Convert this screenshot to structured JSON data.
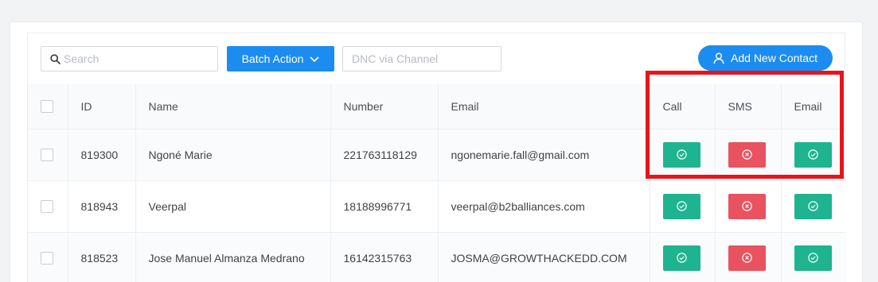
{
  "toolbar": {
    "search_placeholder": "Search",
    "batch_action_label": "Batch Action",
    "dnc_placeholder": "DNC via Channel",
    "add_contact_label": "Add New Contact"
  },
  "table": {
    "headers": {
      "id": "ID",
      "name": "Name",
      "number": "Number",
      "email": "Email",
      "call": "Call",
      "sms": "SMS",
      "email_channel": "Email"
    },
    "rows": [
      {
        "id": "819300",
        "name": "Ngoné Marie",
        "number": "221763118129",
        "email": "ngonemarie.fall@gmail.com",
        "call": "allowed",
        "sms": "blocked",
        "email_channel": "allowed"
      },
      {
        "id": "818943",
        "name": "Veerpal",
        "number": "18188996771",
        "email": "veerpal@b2balliances.com",
        "call": "allowed",
        "sms": "blocked",
        "email_channel": "allowed"
      },
      {
        "id": "818523",
        "name": "Jose Manuel Almanza Medrano",
        "number": "16142315763",
        "email": "JOSMA@GROWTHACKEDD.COM",
        "call": "allowed",
        "sms": "blocked",
        "email_channel": "allowed"
      }
    ]
  },
  "colors": {
    "primary": "#1c8cf0",
    "allowed": "#1eb48f",
    "blocked": "#e9525f",
    "highlight": "#e8141c"
  },
  "icons": {
    "allowed": "check-circle-icon",
    "blocked": "x-circle-icon"
  }
}
